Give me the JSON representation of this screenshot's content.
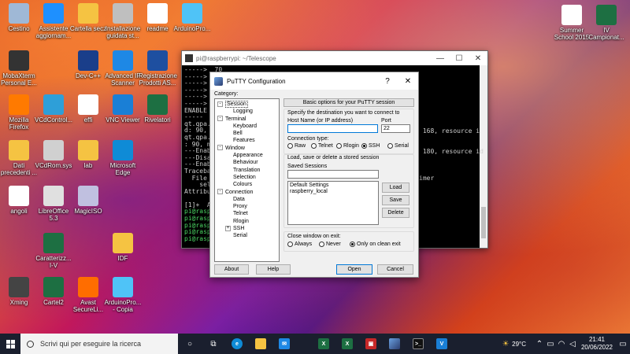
{
  "desktop": {
    "icons_left": [
      {
        "label": "Cestino",
        "icon": "recycle-bin-icon",
        "color": "#9fb8d6"
      },
      {
        "label": "Assistente aggiornam...",
        "icon": "windows-update-icon",
        "color": "#1e90ff"
      },
      {
        "label": "Cartella secz",
        "icon": "folder-icon",
        "color": "#f5c342"
      },
      {
        "label": "Installazione guidata st...",
        "icon": "printer-icon",
        "color": "#bfbfbf"
      },
      {
        "label": "readme",
        "icon": "document-icon",
        "color": "#ffffff"
      },
      {
        "label": "ArduinoPro...",
        "icon": "document-icon",
        "color": "#4fc3f7"
      },
      {
        "label": "MobaXterm Personal E...",
        "icon": "terminal-icon",
        "color": "#333333"
      },
      {
        "label": "Dev-C++",
        "icon": "dev-cpp-icon",
        "color": "#1a3e8a"
      },
      {
        "label": "Advanced IP Scanner",
        "icon": "network-icon",
        "color": "#1e88e5"
      },
      {
        "label": "Registrazione Prodotti AS...",
        "icon": "asus-icon",
        "color": "#1e4fa0"
      },
      {
        "label": "Mozilla Firefox",
        "icon": "firefox-icon",
        "color": "#ff7a00"
      },
      {
        "label": "VCdControl...",
        "icon": "cube-icon",
        "color": "#2e9fd8"
      },
      {
        "label": "effi",
        "icon": "blank-icon",
        "color": "#ffffff"
      },
      {
        "label": "VNC Viewer",
        "icon": "vnc-icon",
        "color": "#1a7fd6"
      },
      {
        "label": "Rivelatori",
        "icon": "excel-icon",
        "color": "#1d6f42"
      },
      {
        "label": "Dati precedenti ...",
        "icon": "folder-icon",
        "color": "#f5c342"
      },
      {
        "label": "VCdRom.sys",
        "icon": "settings-file-icon",
        "color": "#d0d0d0"
      },
      {
        "label": "lab",
        "icon": "folder-icon",
        "color": "#f5c342"
      },
      {
        "label": "Microsoft Edge",
        "icon": "edge-icon",
        "color": "#0f8bd6"
      },
      {
        "label": "angoli",
        "icon": "blank-icon",
        "color": "#ffffff"
      },
      {
        "label": "LibreOffice 5.3",
        "icon": "libreoffice-icon",
        "color": "#e0e0e0"
      },
      {
        "label": "MagicISO",
        "icon": "disc-icon",
        "color": "#c0c0e0"
      },
      {
        "label": "IDF",
        "icon": "folder-icon",
        "color": "#f5c342"
      },
      {
        "label": "Caratterizz... I-V",
        "icon": "excel-icon",
        "color": "#1d6f42"
      },
      {
        "label": "Xming",
        "icon": "xming-icon",
        "color": "#444444"
      },
      {
        "label": "Cartel2",
        "icon": "excel-icon",
        "color": "#1d6f42"
      },
      {
        "label": "Avast SecureLi...",
        "icon": "avast-icon",
        "color": "#ff6d00"
      },
      {
        "label": "ArduinoPro... - Copia",
        "icon": "document-icon",
        "color": "#4fc3f7"
      }
    ],
    "icons_right": [
      {
        "label": "Summer School 2015",
        "icon": "document-icon",
        "color": "#ffffff"
      },
      {
        "label": "IV Campionat...",
        "icon": "excel-icon",
        "color": "#1d6f42"
      }
    ]
  },
  "terminal": {
    "title": "pi@raspberrypi: ~/Telescope",
    "lines": [
      "----->  70",
      "----->",
      "----->",
      "----->",
      "----->",
      "----->",
      "ENABLE",
      "-----",
      "qt.qpa.",
      "d: 90,",
      "qt.qpa.",
      ": 90, m",
      "---Enab",
      "---Disa",
      "---Enab",
      "Traceba",
      "  File",
      "    sel",
      "Attribu",
      "",
      "[1]+  Ab",
      "pi@rasp",
      "pi@rasp",
      "pi@rasp",
      "pi@rasp",
      "pi@rasp"
    ],
    "right_lines": [
      "",
      "",
      "",
      "",
      "",
      "",
      "",
      "",
      " 168, resource i",
      "",
      "",
      " 180, resource id",
      "",
      "",
      "",
      "imer"
    ]
  },
  "putty": {
    "title": "PuTTY Configuration",
    "help_btn": "?",
    "close_btn": "✕",
    "category_label": "Category:",
    "tree": [
      {
        "label": "Session",
        "level": 0,
        "expander": "-",
        "selected": true
      },
      {
        "label": "Logging",
        "level": 1
      },
      {
        "label": "Terminal",
        "level": 0,
        "expander": "-"
      },
      {
        "label": "Keyboard",
        "level": 1
      },
      {
        "label": "Bell",
        "level": 1
      },
      {
        "label": "Features",
        "level": 1
      },
      {
        "label": "Window",
        "level": 0,
        "expander": "-"
      },
      {
        "label": "Appearance",
        "level": 1
      },
      {
        "label": "Behaviour",
        "level": 1
      },
      {
        "label": "Translation",
        "level": 1
      },
      {
        "label": "Selection",
        "level": 1
      },
      {
        "label": "Colours",
        "level": 1
      },
      {
        "label": "Connection",
        "level": 0,
        "expander": "-"
      },
      {
        "label": "Data",
        "level": 1
      },
      {
        "label": "Proxy",
        "level": 1
      },
      {
        "label": "Telnet",
        "level": 1
      },
      {
        "label": "Rlogin",
        "level": 1
      },
      {
        "label": "SSH",
        "level": 1,
        "expander": "+"
      },
      {
        "label": "Serial",
        "level": 1
      }
    ],
    "panel_header": "Basic options for your PuTTY session",
    "dest_heading": "Specify the destination you want to connect to",
    "host_label": "Host Name (or IP address)",
    "host_value": "",
    "port_label": "Port",
    "port_value": "22",
    "conn_type_label": "Connection type:",
    "conn_types": [
      {
        "label": "Raw",
        "checked": false
      },
      {
        "label": "Telnet",
        "checked": false
      },
      {
        "label": "Rlogin",
        "checked": false
      },
      {
        "label": "SSH",
        "checked": true
      },
      {
        "label": "Serial",
        "checked": false
      }
    ],
    "sessions_heading": "Load, save or delete a stored session",
    "saved_sessions_label": "Saved Sessions",
    "saved_sessions_value": "",
    "sessions": [
      "Default Settings",
      "raspberry_local"
    ],
    "load_btn": "Load",
    "save_btn": "Save",
    "delete_btn": "Delete",
    "close_on_exit_label": "Close window on exit:",
    "close_options": [
      {
        "label": "Always",
        "checked": false
      },
      {
        "label": "Never",
        "checked": false
      },
      {
        "label": "Only on clean exit",
        "checked": true
      }
    ],
    "about_btn": "About",
    "help_button": "Help",
    "open_btn": "Open",
    "cancel_btn": "Cancel"
  },
  "taskbar": {
    "search_placeholder": "Scrivi qui per eseguire la ricerca",
    "weather": "29°C",
    "time": "21:41",
    "date": "20/06/2022"
  }
}
